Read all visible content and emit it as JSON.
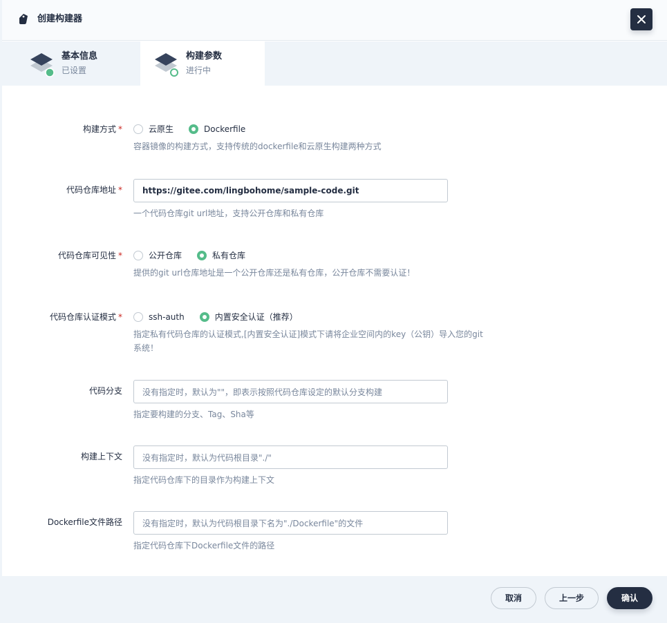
{
  "dialog": {
    "title": "创建构建器"
  },
  "steps": [
    {
      "title": "基本信息",
      "status": "已设置",
      "state": "done"
    },
    {
      "title": "构建参数",
      "status": "进行中",
      "state": "active"
    }
  ],
  "form": {
    "build_method": {
      "label": "构建方式",
      "required": "*",
      "options": [
        "云原生",
        "Dockerfile"
      ],
      "selected": "Dockerfile",
      "description": "容器镜像的构建方式，支持传统的dockerfile和云原生构建两种方式"
    },
    "repo_url": {
      "label": "代码仓库地址",
      "required": "*",
      "value": "https://gitee.com/lingbohome/sample-code.git",
      "description": "一个代码仓库git url地址，支持公开仓库和私有仓库"
    },
    "repo_visibility": {
      "label": "代码仓库可见性",
      "required": "*",
      "options": [
        "公开仓库",
        "私有仓库"
      ],
      "selected": "私有仓库",
      "description": "提供的git url仓库地址是一个公开仓库还是私有仓库，公开仓库不需要认证！"
    },
    "auth_mode": {
      "label": "代码仓库认证模式",
      "required": "*",
      "options": [
        "ssh-auth",
        "内置安全认证（推荐）"
      ],
      "selected": "内置安全认证（推荐）",
      "description": "指定私有代码仓库的认证模式,[内置安全认证]模式下请将企业空间内的key（公钥）导入您的git系统！"
    },
    "branch": {
      "label": "代码分支",
      "placeholder": "没有指定时，默认为\"\"，即表示按照代码仓库设定的默认分支构建",
      "description": "指定要构建的分支、Tag、Sha等"
    },
    "context": {
      "label": "构建上下文",
      "placeholder": "没有指定时，默认为代码根目录\"./\"",
      "description": "指定代码仓库下的目录作为构建上下文"
    },
    "dockerfile_path": {
      "label": "Dockerfile文件路径",
      "placeholder": "没有指定时，默认为代码根目录下名为\"./Dockerfile\"的文件",
      "description": "指定代码仓库下Dockerfile文件的路径"
    }
  },
  "footer": {
    "cancel_label": "取消",
    "prev_label": "上一步",
    "confirm_label": "确认"
  },
  "colors": {
    "accent": "#55bc8a",
    "dark": "#242e42",
    "muted": "#79879c",
    "required": "#ca2621"
  }
}
